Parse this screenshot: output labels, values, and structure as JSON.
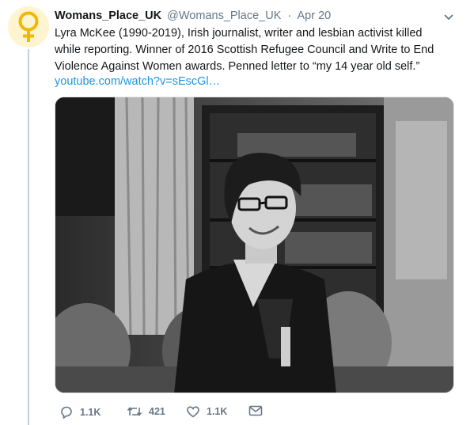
{
  "tweet": {
    "display_name": "Womans_Place_UK",
    "handle": "@Womans_Place_UK",
    "separator": "·",
    "date": "Apr 20",
    "text": "Lyra McKee (1990-2019), Irish journalist, writer and lesbian activist killed while reporting. Winner of 2016 Scottish Refugee Council and Write to End Violence Against Women awards. Penned letter to “my 14 year old self.”",
    "link": "youtube.com/watch?v=sEscGl…"
  },
  "actions": {
    "replies": "1.1K",
    "retweets": "421",
    "likes": "1.1K"
  },
  "icons": {
    "avatar": "venus-symbol-icon",
    "menu": "chevron-down-icon",
    "reply": "reply-icon",
    "retweet": "retweet-icon",
    "like": "heart-icon",
    "share": "envelope-icon"
  },
  "colors": {
    "avatar_symbol": "#f2b705",
    "link": "#1b95e0",
    "muted": "#657786",
    "thread_line": "#c4cfd6"
  }
}
